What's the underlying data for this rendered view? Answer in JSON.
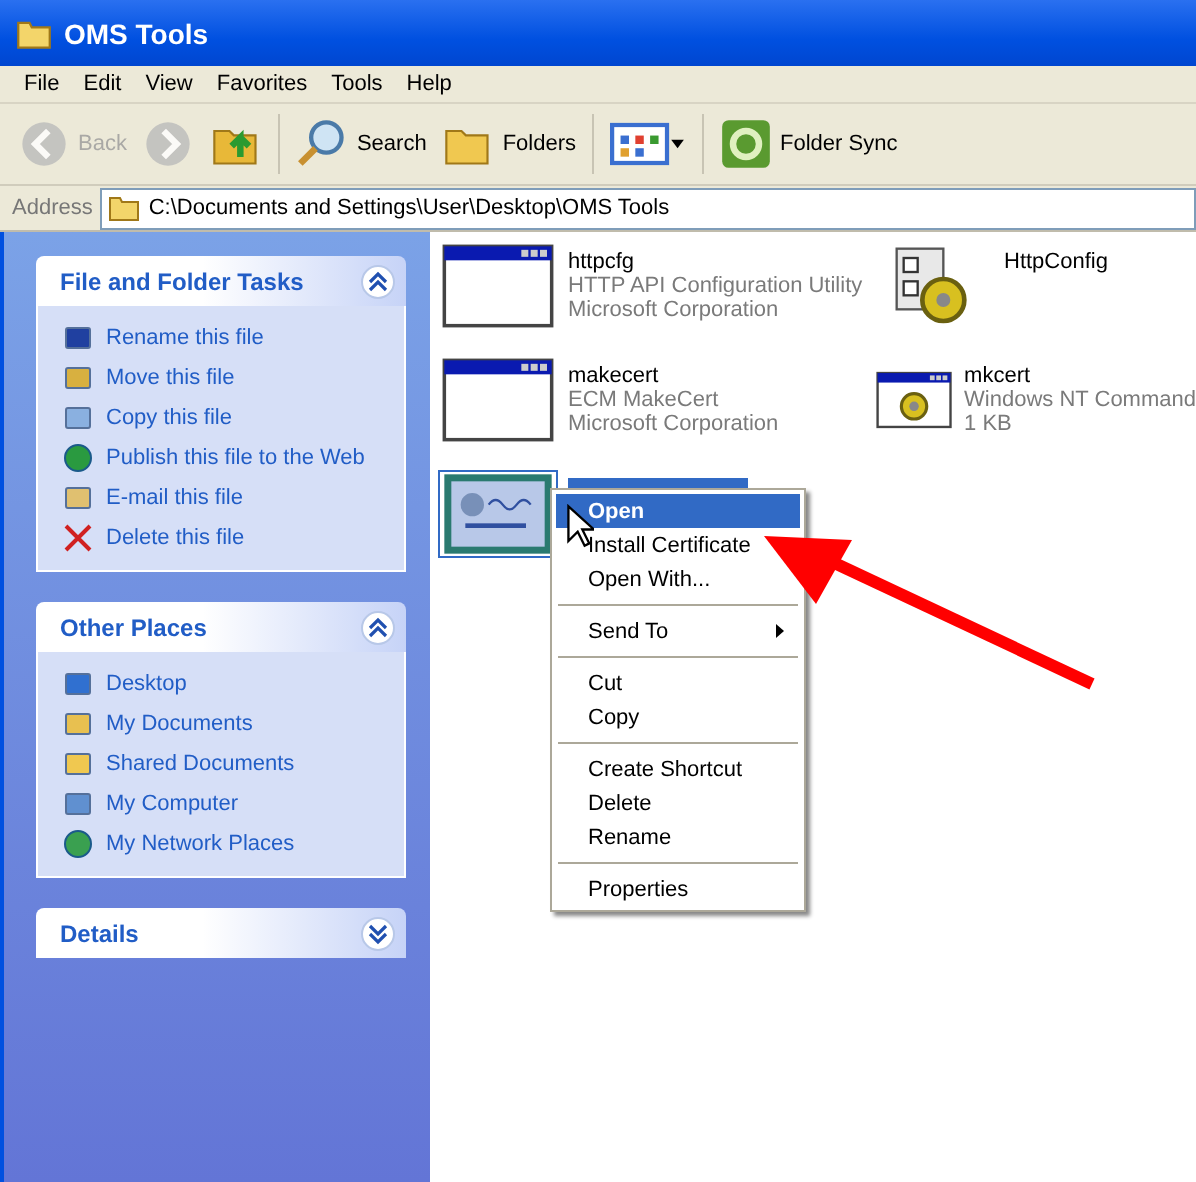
{
  "window": {
    "title": "OMS Tools"
  },
  "menu_bar": [
    "File",
    "Edit",
    "View",
    "Favorites",
    "Tools",
    "Help"
  ],
  "toolbar": [
    {
      "kind": "back",
      "label": "Back",
      "disabled": true
    },
    {
      "kind": "forward",
      "disabled": true
    },
    {
      "kind": "up"
    },
    {
      "kind": "search",
      "label": "Search"
    },
    {
      "kind": "folders",
      "label": "Folders"
    },
    {
      "kind": "views"
    },
    {
      "kind": "sync",
      "label": "Folder Sync"
    }
  ],
  "address_bar": {
    "label": "Address",
    "value": "C:\\Documents and Settings\\User\\Desktop\\OMS Tools"
  },
  "task_panes": [
    {
      "title": "File and Folder Tasks",
      "expanded": true,
      "items": [
        {
          "kind": "rename",
          "label": "Rename this file"
        },
        {
          "kind": "move",
          "label": "Move this file"
        },
        {
          "kind": "copy",
          "label": "Copy this file"
        },
        {
          "kind": "publish",
          "label": "Publish this file to the Web"
        },
        {
          "kind": "email",
          "label": "E-mail this file"
        },
        {
          "kind": "delete",
          "label": "Delete this file"
        }
      ]
    },
    {
      "title": "Other Places",
      "expanded": true,
      "items": [
        {
          "kind": "desktop",
          "label": "Desktop"
        },
        {
          "kind": "documents",
          "label": "My Documents"
        },
        {
          "kind": "folder",
          "label": "Shared Documents"
        },
        {
          "kind": "computer",
          "label": "My Computer"
        },
        {
          "kind": "network",
          "label": "My Network Places"
        }
      ]
    },
    {
      "title": "Details",
      "expanded": false
    }
  ],
  "files": [
    {
      "kind": "window",
      "name": "httpcfg",
      "lines": [
        "HTTP API Configuration Utility",
        "Microsoft Corporation"
      ],
      "selected": false
    },
    {
      "kind": "config",
      "name": "HttpConfig",
      "selected": false
    },
    {
      "kind": "window",
      "name": "makecert",
      "lines": [
        "ECM MakeCert",
        "Microsoft Corporation"
      ],
      "selected": false
    },
    {
      "kind": "command",
      "name": "mkcert",
      "lines": [
        "Windows NT Command",
        "1 KB"
      ],
      "selected": false
    },
    {
      "kind": "certificate",
      "selected": true
    }
  ],
  "context_menu": [
    {
      "kind": "item",
      "label": "Open",
      "default": true,
      "selected": true
    },
    {
      "kind": "item",
      "label": "Install Certificate",
      "default": false,
      "selected": false
    },
    {
      "kind": "item",
      "label": "Open With...",
      "default": false,
      "selected": false
    },
    {
      "kind": "separator"
    },
    {
      "kind": "submenu",
      "label": "Send To",
      "default": false,
      "selected": false
    },
    {
      "kind": "separator"
    },
    {
      "kind": "item",
      "label": "Cut",
      "default": false,
      "selected": false
    },
    {
      "kind": "item",
      "label": "Copy",
      "default": false,
      "selected": false
    },
    {
      "kind": "separator"
    },
    {
      "kind": "item",
      "label": "Create Shortcut",
      "default": false,
      "selected": false
    },
    {
      "kind": "item",
      "label": "Delete",
      "default": false,
      "selected": false
    },
    {
      "kind": "item",
      "label": "Rename",
      "default": false,
      "selected": false
    },
    {
      "kind": "separator"
    },
    {
      "kind": "item",
      "label": "Properties",
      "default": false,
      "selected": false
    }
  ]
}
